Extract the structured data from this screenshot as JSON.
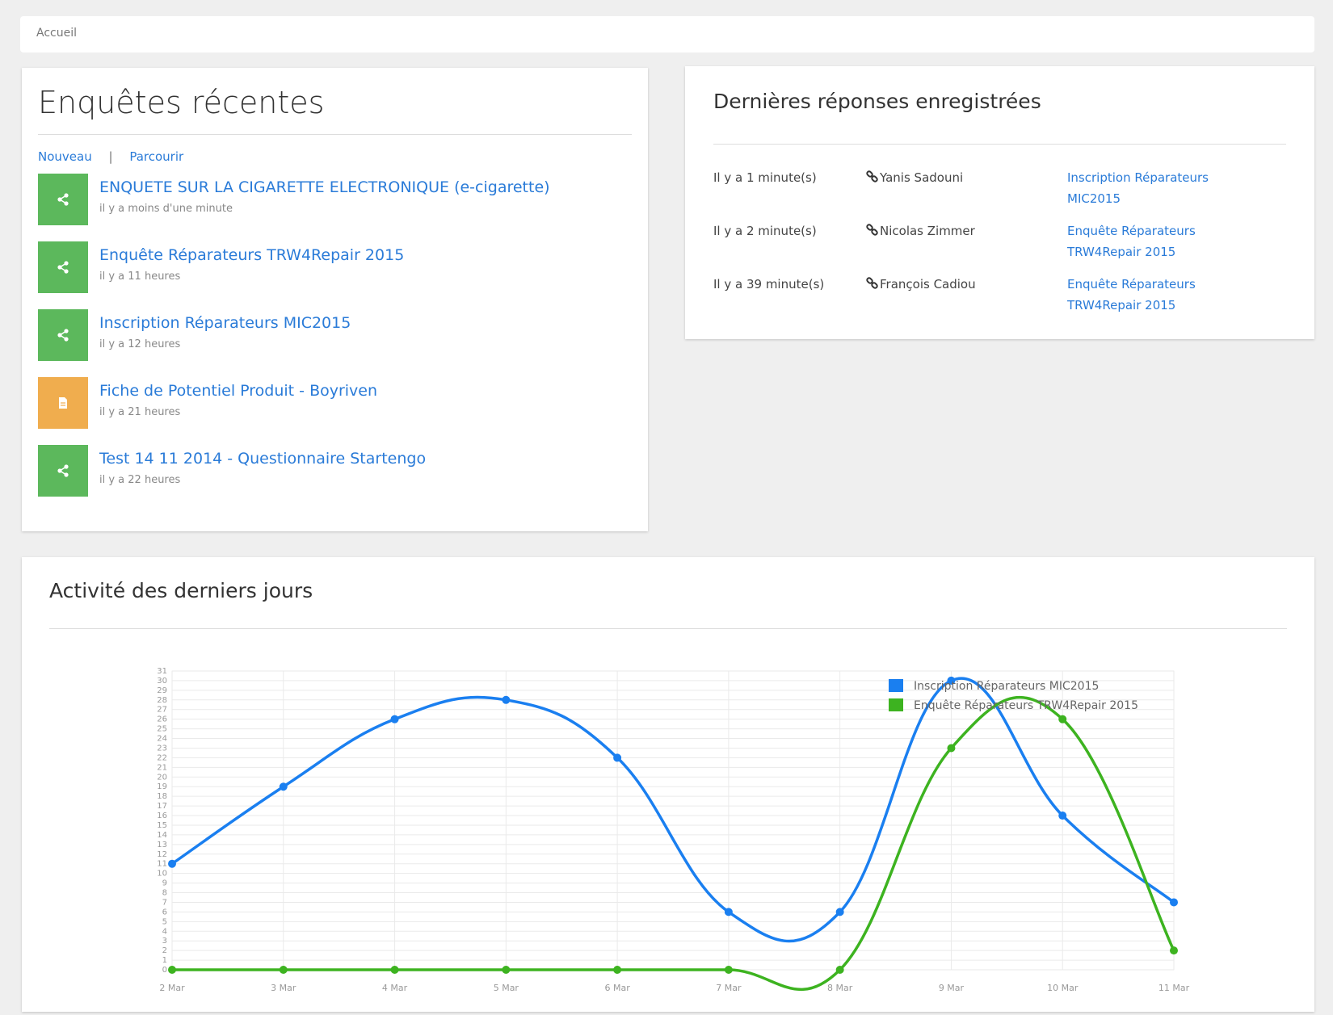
{
  "breadcrumb": {
    "label": "Accueil"
  },
  "recent": {
    "title": "Enquêtes récentes",
    "new_label": "Nouveau",
    "separator": "|",
    "browse_label": "Parcourir",
    "items": [
      {
        "title": "ENQUETE SUR LA CIGARETTE ELECTRONIQUE (e-cigarette)",
        "time": "il y a moins d'une minute",
        "icon": "share-icon",
        "color": "#5cb85c"
      },
      {
        "title": "Enquête Réparateurs TRW4Repair 2015",
        "time": "il y a 11 heures",
        "icon": "share-icon",
        "color": "#5cb85c"
      },
      {
        "title": "Inscription Réparateurs MIC2015",
        "time": "il y a 12 heures",
        "icon": "share-icon",
        "color": "#5cb85c"
      },
      {
        "title": "Fiche de Potentiel Produit - Boyriven",
        "time": "il y a 21 heures",
        "icon": "document-icon",
        "color": "#f0ad4e"
      },
      {
        "title": "Test 14 11 2014 - Questionnaire Startengo",
        "time": "il y a 22 heures",
        "icon": "share-icon",
        "color": "#5cb85c"
      }
    ]
  },
  "responses": {
    "title": "Dernières réponses enregistrées",
    "rows": [
      {
        "time": "Il y a 1 minute(s)",
        "user": "Yanis Sadouni",
        "survey": "Inscription Réparateurs MIC2015"
      },
      {
        "time": "Il y a 2 minute(s)",
        "user": "Nicolas Zimmer",
        "survey": "Enquête Réparateurs TRW4Repair 2015"
      },
      {
        "time": "Il y a 39 minute(s)",
        "user": "François Cadiou",
        "survey": "Enquête Réparateurs TRW4Repair 2015"
      }
    ]
  },
  "activity": {
    "title": "Activité des derniers jours"
  },
  "chart_data": {
    "type": "line",
    "title": "",
    "xlabel": "",
    "ylabel": "",
    "categories": [
      "2 Mar",
      "3 Mar",
      "4 Mar",
      "5 Mar",
      "6 Mar",
      "7 Mar",
      "8 Mar",
      "9 Mar",
      "10 Mar",
      "11 Mar"
    ],
    "ylim": [
      0,
      31
    ],
    "y_ticks": [
      0,
      1,
      2,
      3,
      4,
      5,
      6,
      7,
      8,
      9,
      10,
      11,
      12,
      13,
      14,
      15,
      16,
      17,
      18,
      19,
      20,
      21,
      22,
      23,
      24,
      25,
      26,
      27,
      28,
      29,
      30,
      31
    ],
    "grid": true,
    "legend_position": "top-right",
    "series": [
      {
        "name": "Inscription Réparateurs MIC2015",
        "color": "#1a7ff0",
        "values": [
          11,
          19,
          26,
          28,
          22,
          6,
          6,
          30,
          16,
          7
        ]
      },
      {
        "name": "Enquête Réparateurs TRW4Repair 2015",
        "color": "#3db320",
        "values": [
          0,
          0,
          0,
          0,
          0,
          0,
          0,
          23,
          26,
          2
        ]
      }
    ]
  }
}
